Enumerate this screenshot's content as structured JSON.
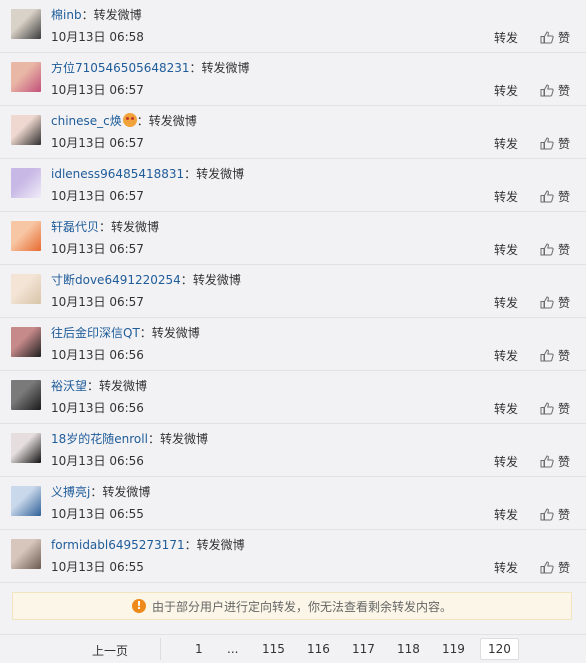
{
  "actions": {
    "repost": "转发",
    "like": "赞"
  },
  "items": [
    {
      "user": "棉inb",
      "sep": "：",
      "text": "转发微博",
      "time": "10月13日 06:58",
      "avatar_colors": [
        "#3b3b3b",
        "#d9d2c8"
      ]
    },
    {
      "user": "方位710546505648231",
      "sep": "：",
      "text": "转发微博",
      "time": "10月13日 06:57",
      "avatar_colors": [
        "#c2507a",
        "#e9b7a6"
      ]
    },
    {
      "user": "chinese_c焕",
      "sep": "：",
      "text": "转发微博",
      "time": "10月13日 06:57",
      "avatar_colors": [
        "#2d2d2d",
        "#efd8cf"
      ],
      "emoji": true
    },
    {
      "user": "idleness96485418831",
      "sep": "：",
      "text": "转发微博",
      "time": "10月13日 06:57",
      "avatar_colors": [
        "#f1ecf7",
        "#c7b8e6"
      ]
    },
    {
      "user": "轩磊代贝",
      "sep": "：",
      "text": "转发微博",
      "time": "10月13日 06:57",
      "avatar_colors": [
        "#e86a2f",
        "#f7c7a5"
      ]
    },
    {
      "user": "寸断dove6491220254",
      "sep": "：",
      "text": "转发微博",
      "time": "10月13日 06:57",
      "avatar_colors": [
        "#d8c4a8",
        "#f3e4d5"
      ]
    },
    {
      "user": "往后金印深信QT",
      "sep": "：",
      "text": "转发微博",
      "time": "10月13日 06:56",
      "avatar_colors": [
        "#1f1f1f",
        "#c78a8a"
      ]
    },
    {
      "user": "裕沃望",
      "sep": "：",
      "text": "转发微博",
      "time": "10月13日 06:56",
      "avatar_colors": [
        "#1a1a1a",
        "#7a7a7a"
      ]
    },
    {
      "user": "18岁的花随enroll",
      "sep": "：",
      "text": "转发微博",
      "time": "10月13日 06:56",
      "avatar_colors": [
        "#111111",
        "#e6dede"
      ]
    },
    {
      "user": "义搏亮j",
      "sep": "：",
      "text": "转发微博",
      "time": "10月13日 06:55",
      "avatar_colors": [
        "#2f5f98",
        "#c9d8ea"
      ]
    },
    {
      "user": "formidabl6495273171",
      "sep": "：",
      "text": "转发微博",
      "time": "10月13日 06:55",
      "avatar_colors": [
        "#6b5a4f",
        "#d6c6bb"
      ]
    }
  ],
  "notice": {
    "icon": "warning-icon",
    "text": "由于部分用户进行定向转发，你无法查看剩余转发内容。",
    "accent": "#ee8a1c"
  },
  "pagination": {
    "prev": "上一页",
    "pages": [
      "1",
      "...",
      "115",
      "116",
      "117",
      "118",
      "119",
      "120"
    ],
    "current": "120"
  }
}
